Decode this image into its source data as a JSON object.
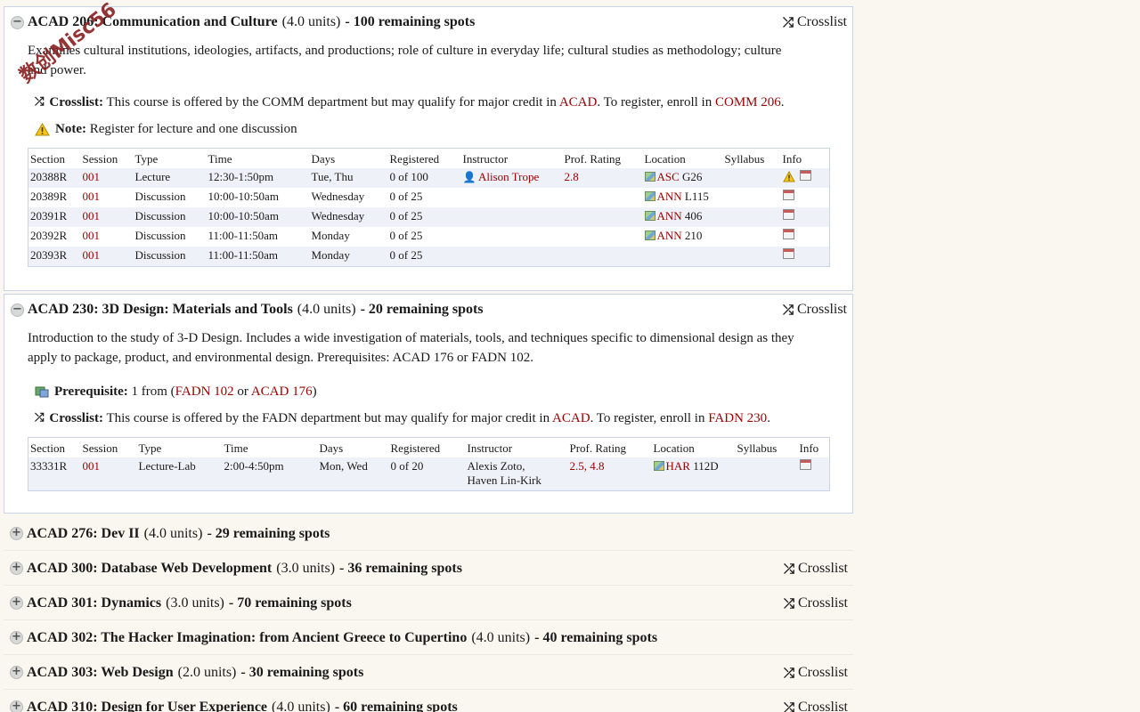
{
  "courses": [
    {
      "code_title": "ACAD 206: Communication and Culture",
      "units": "(4.0 units)",
      "spots": "- 100 remaining spots",
      "crosslist_label": "Crosslist",
      "description": "Examines cultural institutions, ideologies, artifacts, and productions; role of culture in everyday life; cultural studies as methodology; culture and power.",
      "crosslist_note": {
        "label": "Crosslist:",
        "text_before": "This course is offered by the COMM department but may qualify for major credit in",
        "link1": "ACAD",
        "text_mid": ". To register, enroll in",
        "link2": "COMM 206",
        "text_end": "."
      },
      "note": {
        "label": "Note:",
        "text": "Register for lecture and one discussion"
      },
      "table_headers": [
        "Section",
        "Session",
        "Type",
        "Time",
        "Days",
        "Registered",
        "Instructor",
        "Prof. Rating",
        "Location",
        "Syllabus",
        "Info"
      ],
      "rows": [
        {
          "section": "20388R",
          "session": "001",
          "type": "Lecture",
          "time": "12:30-1:50pm",
          "days": "Tue, Thu",
          "registered": "0 of 100",
          "instructor": "Alison Trope",
          "rating": "2.8",
          "loc_bldg": "ASC",
          "loc_room": "G26"
        },
        {
          "section": "20389R",
          "session": "001",
          "type": "Discussion",
          "time": "10:00-10:50am",
          "days": "Wednesday",
          "registered": "0 of 25",
          "instructor": "",
          "rating": "",
          "loc_bldg": "ANN",
          "loc_room": "L115"
        },
        {
          "section": "20391R",
          "session": "001",
          "type": "Discussion",
          "time": "10:00-10:50am",
          "days": "Wednesday",
          "registered": "0 of 25",
          "instructor": "",
          "rating": "",
          "loc_bldg": "ANN",
          "loc_room": "406"
        },
        {
          "section": "20392R",
          "session": "001",
          "type": "Discussion",
          "time": "11:00-11:50am",
          "days": "Monday",
          "registered": "0 of 25",
          "instructor": "",
          "rating": "",
          "loc_bldg": "ANN",
          "loc_room": "210"
        },
        {
          "section": "20393R",
          "session": "001",
          "type": "Discussion",
          "time": "11:00-11:50am",
          "days": "Monday",
          "registered": "0 of 25",
          "instructor": "",
          "rating": "",
          "loc_bldg": "",
          "loc_room": ""
        }
      ]
    },
    {
      "code_title": "ACAD 230: 3D Design: Materials and Tools",
      "units": "(4.0 units)",
      "spots": "- 20 remaining spots",
      "crosslist_label": "Crosslist",
      "description": "Introduction to the study of 3-D Design. Includes a wide investigation of materials, tools, and techniques specific to dimensional design as they apply to package, product, and environmental design. Prerequisites: ACAD 176 or FADN 102.",
      "prereq": {
        "label": "Prerequisite:",
        "text_before": "1 from (",
        "link1": "FADN 102",
        "text_mid": " or ",
        "link2": "ACAD 176",
        "text_end": ")"
      },
      "crosslist_note": {
        "label": "Crosslist:",
        "text_before": "This course is offered by the FADN department but may qualify for major credit in",
        "link1": "ACAD",
        "text_mid": ". To register, enroll in",
        "link2": "FADN 230",
        "text_end": "."
      },
      "table_headers": [
        "Section",
        "Session",
        "Type",
        "Time",
        "Days",
        "Registered",
        "Instructor",
        "Prof. Rating",
        "Location",
        "Syllabus",
        "Info"
      ],
      "rows": [
        {
          "section": "33331R",
          "session": "001",
          "type": "Lecture-Lab",
          "time": "2:00-4:50pm",
          "days": "Mon, Wed",
          "registered": "0 of 20",
          "instructor_line1": "Alexis Zoto,",
          "instructor_line2": "Haven Lin-Kirk",
          "rating1": "2.5",
          "rating_sep": ", ",
          "rating2": "4.8",
          "loc_bldg": "HAR",
          "loc_room": "112D"
        }
      ]
    }
  ],
  "collapsed": [
    {
      "code_title": "ACAD 276: Dev II",
      "units": "(4.0 units)",
      "spots": "- 29 remaining spots",
      "crosslist_label": ""
    },
    {
      "code_title": "ACAD 300: Database Web Development",
      "units": "(3.0 units)",
      "spots": "- 36 remaining spots",
      "crosslist_label": "Crosslist"
    },
    {
      "code_title": "ACAD 301: Dynamics",
      "units": "(3.0 units)",
      "spots": "- 70 remaining spots",
      "crosslist_label": "Crosslist"
    },
    {
      "code_title": "ACAD 302: The Hacker Imagination: from Ancient Greece to Cupertino",
      "units": "(4.0 units)",
      "spots": "- 40 remaining spots",
      "crosslist_label": ""
    },
    {
      "code_title": "ACAD 303: Web Design",
      "units": "(2.0 units)",
      "spots": "- 30 remaining spots",
      "crosslist_label": "Crosslist"
    },
    {
      "code_title": "ACAD 310: Design for User Experience",
      "units": "(4.0 units)",
      "spots": "- 60 remaining spots",
      "crosslist_label": "Crosslist"
    }
  ],
  "toggle_expanded": "−",
  "toggle_collapsed": "+",
  "watermark": "数创Misc56",
  "colors": {
    "link": "#990000",
    "row_alt": "#eef1f7",
    "border": "#c9d3e6",
    "background": "#f9f7ef"
  }
}
